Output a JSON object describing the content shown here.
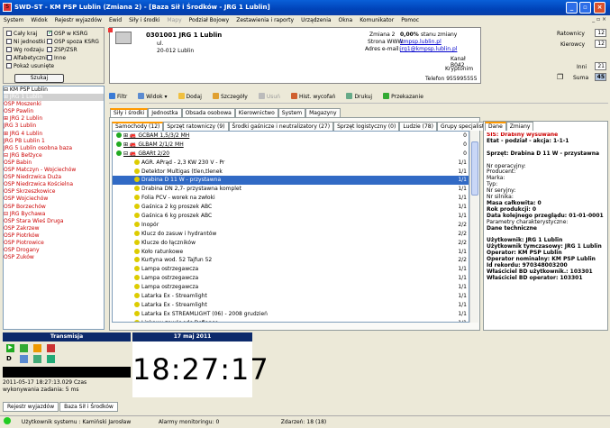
{
  "window": {
    "title": "SWD-ST - KM PSP Lublin (Zmiana 2) - [Baza Sił i Środków - JRG 1 Lublin]",
    "app_icon": "S"
  },
  "menu": [
    {
      "label": "System",
      "dis": false
    },
    {
      "label": "Widok",
      "dis": false
    },
    {
      "label": "Rejestr wyjazdów",
      "dis": false
    },
    {
      "label": "Ewid",
      "dis": false
    },
    {
      "label": "Siły i środki",
      "dis": false
    },
    {
      "label": "Mapy",
      "dis": true
    },
    {
      "label": "Podział Bojowy",
      "dis": false
    },
    {
      "label": "Zestawienia i raporty",
      "dis": false
    },
    {
      "label": "Urządzenia",
      "dis": false
    },
    {
      "label": "Okna",
      "dis": false
    },
    {
      "label": "Komunikator",
      "dis": false
    },
    {
      "label": "Pomoc",
      "dis": false
    }
  ],
  "mdi_controls": "_ ▫ ×",
  "filters": {
    "items": [
      {
        "label": "Cały kraj",
        "checked": false
      },
      {
        "label": "OSP w KSRG",
        "checked": true
      },
      {
        "label": "Ni jednostki",
        "checked": false
      },
      {
        "label": "OSP spoza KSRG",
        "checked": false
      },
      {
        "label": "Wg rodzaju",
        "checked": false
      },
      {
        "label": "ZSP/ZSR",
        "checked": false
      },
      {
        "label": "Alfabetycznie",
        "checked": false
      },
      {
        "label": "Inne",
        "checked": false
      },
      {
        "label": "Pokaż usunięte",
        "checked": false
      }
    ],
    "search_button": "Szukaj"
  },
  "unit": {
    "code": "0301001 JRG 1 Lublin",
    "street": "ul.",
    "city": "20-012 Lublin",
    "zmiana_label": "Zmiana 2",
    "zmiana_value": "0,00%",
    "zmiana_suffix": "stanu zmiany",
    "www_label": "Strona WWW:",
    "www_value": "kmpsp.lublin.pl",
    "email_label": "Adres e-mail:",
    "email_value": "jrg1@kmpsp.lublin.pl",
    "kanal": "Kanał B042",
    "kryptonim": "Kryptonim",
    "telefon": "Telefon 955995555"
  },
  "counters": {
    "ratownicy_label": "Ratownicy",
    "ratownicy": "12",
    "kierowcy_label": "Kierowcy",
    "kierowcy": "12",
    "inni_label": "Inni",
    "inni": "21",
    "suma_label": "Suma",
    "suma": "45"
  },
  "tree": [
    {
      "t": "⊟ KM PSP Lublin",
      "c": ""
    },
    {
      "t": "⊞ JRG 1 Lublin",
      "c": "sel"
    },
    {
      "t": "  OSP Moszenki",
      "c": "red"
    },
    {
      "t": "  OSP Pawlin",
      "c": "red"
    },
    {
      "t": "⊞ JRG 2 Lublin",
      "c": "red"
    },
    {
      "t": "  JRG 3 Lublin",
      "c": "red"
    },
    {
      "t": "⊞ JRG 4 Lublin",
      "c": "red"
    },
    {
      "t": "  JRG PB Lublin 1",
      "c": "red"
    },
    {
      "t": "  JRG 5 Lublin osobna baza",
      "c": "red"
    },
    {
      "t": "⊟ JRG Bełżyce",
      "c": "red"
    },
    {
      "t": "    OSP Babin",
      "c": "red"
    },
    {
      "t": "    OSP Matczyn - Wojciechów",
      "c": "red"
    },
    {
      "t": "    OSP Niedrzwica Duża",
      "c": "red"
    },
    {
      "t": "    OSP Niedrzwica Kościelna",
      "c": "red"
    },
    {
      "t": "    OSP Skrzeszkowice",
      "c": "red"
    },
    {
      "t": "    OSP Wojciechów",
      "c": "red"
    },
    {
      "t": "    OSP Borzechów",
      "c": "red"
    },
    {
      "t": "⊟ JRG Bychawa",
      "c": "red"
    },
    {
      "t": "    OSP Stara Wieś Druga",
      "c": "red"
    },
    {
      "t": "    OSP Zakrzew",
      "c": "red"
    },
    {
      "t": "    OSP Piotrków",
      "c": "red"
    },
    {
      "t": "    OSP Piotrowice",
      "c": "red"
    },
    {
      "t": "    OSP Drogany",
      "c": "red"
    },
    {
      "t": "    OSP Zuków",
      "c": "red"
    }
  ],
  "toolbar": [
    {
      "label": "Filtr",
      "icon": "filter-icon",
      "color": "#3a7bd5",
      "dis": false
    },
    {
      "label": "Widok ▾",
      "icon": "view-icon",
      "color": "#5b8bd0",
      "dis": false
    },
    {
      "label": "Dodaj",
      "icon": "add-icon",
      "color": "#f0c040",
      "dis": false
    },
    {
      "label": "Szczegóły",
      "icon": "details-icon",
      "color": "#e0a030",
      "dis": false
    },
    {
      "label": "Usuń",
      "icon": "delete-icon",
      "color": "#bbb",
      "dis": true
    },
    {
      "label": "Hist. wycofań",
      "icon": "history-icon",
      "color": "#d06030",
      "dis": false
    },
    {
      "label": "Drukuj",
      "icon": "print-icon",
      "color": "#6a8",
      "dis": false
    },
    {
      "label": "Przekazanie",
      "icon": "transfer-icon",
      "color": "#3a3",
      "dis": false
    }
  ],
  "tabs_top": [
    "Siły i środki",
    "Jednostka",
    "Obsada osobowa",
    "Kierownictwo",
    "System",
    "Magazyny"
  ],
  "tabs_sub": [
    "Samochody (12)",
    "Sprzęt ratowniczy (9)",
    "Środki gaśnicze i neutralizatory (27)",
    "Sprzęt logistyczny (0)",
    "Ludzie (78)",
    "Grupy specjalistyczne"
  ],
  "list_rows": [
    {
      "t": "⊞ 🚒 GCBAM 1,5/3/2 MH",
      "q": "0",
      "d": "g",
      "i": 0,
      "sel": false,
      "u": true
    },
    {
      "t": "⊞ 🚒 GLBAM 2/1/2 MH",
      "q": "0",
      "d": "g",
      "i": 0,
      "sel": false,
      "u": true
    },
    {
      "t": "⊟ 🚒 GBARt 2/20",
      "q": "0",
      "d": "g",
      "i": 0,
      "sel": false,
      "u": true
    },
    {
      "t": "AGR. APrąd - 2,3 KW 230 V - Pr",
      "q": "1/1",
      "d": "y",
      "i": 1,
      "sel": false,
      "u": false
    },
    {
      "t": "Detektor Multigas (tlen,tlenek",
      "q": "1/1",
      "d": "y",
      "i": 1,
      "sel": false,
      "u": false
    },
    {
      "t": "Drabina D 11 W - przystawna",
      "q": "1/1",
      "d": "y",
      "i": 1,
      "sel": true,
      "u": false
    },
    {
      "t": "Drabina DN 2,7- przystawna komplet",
      "q": "1/1",
      "d": "y",
      "i": 1,
      "sel": false,
      "u": false
    },
    {
      "t": "Folia PCV - worek na zwłoki",
      "q": "1/1",
      "d": "y",
      "i": 1,
      "sel": false,
      "u": false
    },
    {
      "t": "Gaśnica 2 kg proszek ABC",
      "q": "1/1",
      "d": "y",
      "i": 1,
      "sel": false,
      "u": false
    },
    {
      "t": "Gaśnica 6 kg proszek ABC",
      "q": "1/1",
      "d": "y",
      "i": 1,
      "sel": false,
      "u": false
    },
    {
      "t": "Inopór",
      "q": "2/2",
      "d": "y",
      "i": 1,
      "sel": false,
      "u": false
    },
    {
      "t": "Klucz do zasuw i hydrantów",
      "q": "2/2",
      "d": "y",
      "i": 1,
      "sel": false,
      "u": false
    },
    {
      "t": "Klucze do łączników",
      "q": "2/2",
      "d": "y",
      "i": 1,
      "sel": false,
      "u": false
    },
    {
      "t": "Koło ratunkowe",
      "q": "1/1",
      "d": "y",
      "i": 1,
      "sel": false,
      "u": false
    },
    {
      "t": "Kurtyna wod. 52 Tajfun 52",
      "q": "2/2",
      "d": "y",
      "i": 1,
      "sel": false,
      "u": false
    },
    {
      "t": "Lampa ostrzegawcza",
      "q": "1/1",
      "d": "y",
      "i": 1,
      "sel": false,
      "u": false
    },
    {
      "t": "Lampa ostrzegawcza",
      "q": "1/1",
      "d": "y",
      "i": 1,
      "sel": false,
      "u": false
    },
    {
      "t": "Lampa ostrzegawcza",
      "q": "1/1",
      "d": "y",
      "i": 1,
      "sel": false,
      "u": false
    },
    {
      "t": "Latarka Ex - Streamlight",
      "q": "1/1",
      "d": "y",
      "i": 1,
      "sel": false,
      "u": false
    },
    {
      "t": "Latarka Ex - Streamlight",
      "q": "1/1",
      "d": "y",
      "i": 1,
      "sel": false,
      "u": false
    },
    {
      "t": "Latarka Ex STREAMLIGHT (06) - 2008 grudzień",
      "q": "1/1",
      "d": "y",
      "i": 1,
      "sel": false,
      "u": false
    },
    {
      "t": "Linkowy zawór odc.Defiance",
      "q": "1/1",
      "d": "y",
      "i": 1,
      "sel": false,
      "u": false
    }
  ],
  "detail_tabs": [
    "Dane",
    "Zmiany"
  ],
  "detail": [
    {
      "t": "SIS: Drabiny wysuwane",
      "s": "red"
    },
    {
      "t": "Etat - podział - akcja: 1-1-1",
      "s": "b"
    },
    {
      "t": "",
      "s": ""
    },
    {
      "t": "Sprzęt: Drabina D 11 W - przystawna",
      "s": "b"
    },
    {
      "t": "",
      "s": ""
    },
    {
      "t": "Nr operacyjny:",
      "s": ""
    },
    {
      "t": "Producent:",
      "s": ""
    },
    {
      "t": "Marka:",
      "s": ""
    },
    {
      "t": "Typ:",
      "s": ""
    },
    {
      "t": "Nr seryjny:",
      "s": ""
    },
    {
      "t": "Nr silnika:",
      "s": ""
    },
    {
      "t": "Masa całkowita: 0",
      "s": "b"
    },
    {
      "t": "Rok produkcji: 0",
      "s": "b"
    },
    {
      "t": "Data kolejnego przeglądu: 01-01-0001",
      "s": "b"
    },
    {
      "t": "Parametry charakterystyczne:",
      "s": ""
    },
    {
      "t": "Dane techniczne",
      "s": "b"
    },
    {
      "t": "",
      "s": ""
    },
    {
      "t": "Użytkownik: JRG 1 Lublin",
      "s": "b"
    },
    {
      "t": "Użytkownik tymczasowy: JRG 1 Lublin",
      "s": "b"
    },
    {
      "t": "Operator: KM PSP Lublin",
      "s": "b"
    },
    {
      "t": "Operator nominalny: KM PSP Lublin",
      "s": "b"
    },
    {
      "t": "Id rekordu: 970348003200",
      "s": "b"
    },
    {
      "t": "Właściciel BD użytkownik.: 103301",
      "s": "b"
    },
    {
      "t": "Właściciel BD operator: 103301",
      "s": "b"
    }
  ],
  "transmisja": {
    "title": "Transmisja",
    "line1": "2011-05-17 18:27:13.029 Czas",
    "line2": "wykonywania zadania: 5 ms"
  },
  "clock": {
    "date": "17 maj 2011",
    "time": "18:27:17"
  },
  "bottom_tabs": [
    "Rejestr wyjazdów",
    "Baza Sił i Środków"
  ],
  "status": {
    "user": "Użytkownik systemu : Kamiński Jarosław",
    "alarms": "Alarmy monitoringu: 0",
    "events": "Zdarzeń: 18 (18)"
  }
}
